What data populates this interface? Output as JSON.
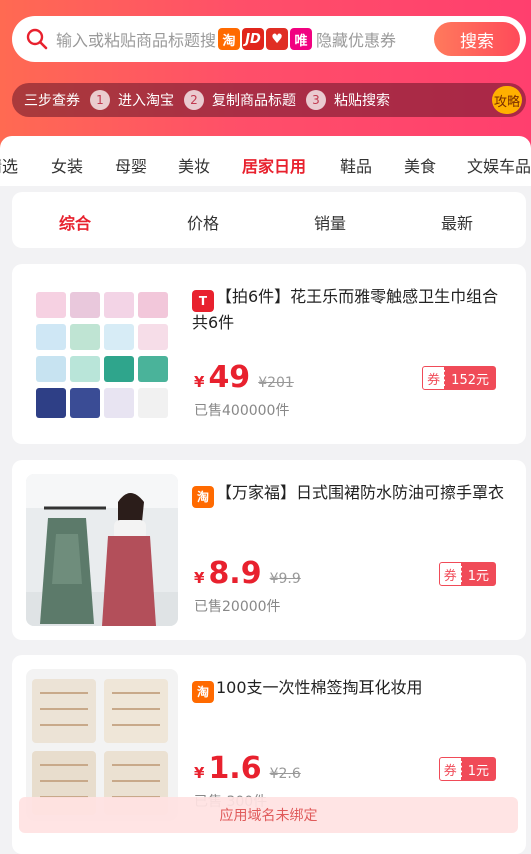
{
  "search": {
    "placeholder_left": "输入或粘贴商品标题搜",
    "placeholder_right": "隐藏优惠券",
    "button": "搜索",
    "platforms": [
      {
        "name": "taobao",
        "label": "淘"
      },
      {
        "name": "jd",
        "label": "JD"
      },
      {
        "name": "pinduoduo",
        "label": "♥"
      },
      {
        "name": "vip",
        "label": "唯"
      }
    ]
  },
  "steps": {
    "intro": "三步查券",
    "items": [
      {
        "num": "1",
        "label": "进入淘宝"
      },
      {
        "num": "2",
        "label": "复制商品标题"
      },
      {
        "num": "3",
        "label": "粘贴搜索"
      }
    ],
    "guide": "攻略"
  },
  "categories": [
    "精选",
    "女装",
    "母婴",
    "美妆",
    "居家日用",
    "鞋品",
    "美食",
    "文娱车品"
  ],
  "active_category": "居家日用",
  "sort": [
    "综合",
    "价格",
    "销量",
    "最新"
  ],
  "active_sort": "综合",
  "products": [
    {
      "platform": "tmall",
      "badge": "T",
      "title": "【拍6件】花王乐而雅零触感卫生巾组合共6件",
      "currency": "¥",
      "price": "49",
      "original": "¥201",
      "sold": "已售400000件",
      "coupon_label": "券",
      "coupon_value": "152元"
    },
    {
      "platform": "taobao",
      "badge": "淘",
      "title": "【万家福】日式围裙防水防油可擦手罩衣",
      "currency": "¥",
      "price": "8.9",
      "original": "¥9.9",
      "sold": "已售20000件",
      "coupon_label": "券",
      "coupon_value": "1元"
    },
    {
      "platform": "taobao",
      "badge": "淘",
      "title": "100支一次性棉签掏耳化妆用",
      "currency": "¥",
      "price": "1.6",
      "original": "¥2.6",
      "sold": "已售 300件",
      "coupon_label": "券",
      "coupon_value": "1元"
    }
  ],
  "toast": "应用域名未绑定",
  "colors": {
    "accent": "#e8212e",
    "hero_start": "#ff6a52",
    "hero_end": "#ff3f6e",
    "coupon": "#f04b58",
    "guide": "#ffb000"
  }
}
